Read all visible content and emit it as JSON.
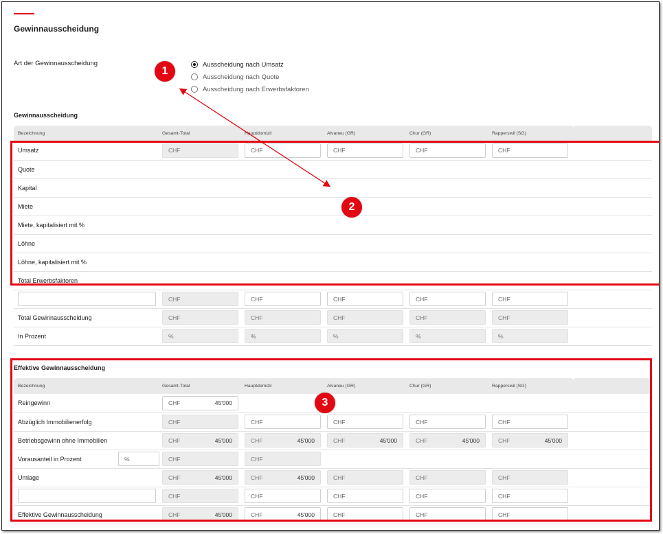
{
  "page_title": "Gewinnausscheidung",
  "art": {
    "label": "Art der Gewinnausscheidung",
    "options": [
      {
        "label": "Ausscheidung nach Umsatz",
        "selected": true
      },
      {
        "label": "Ausscheidung nach Quote",
        "selected": false
      },
      {
        "label": "Ausscheidung nach Erwerbsfaktoren",
        "selected": false
      }
    ]
  },
  "columns": [
    "Bezeichnung",
    "Gesamt-Total",
    "Hauptdomizil",
    "Alvaneu (GR)",
    "Chur (GR)",
    "Rapperswil (SG)"
  ],
  "section1": {
    "title": "Gewinnausscheidung",
    "rows": [
      {
        "label": "Umsatz",
        "cells": [
          {
            "ph": "CHF",
            "ro": true
          },
          {
            "ph": "CHF",
            "ro": false
          },
          {
            "ph": "CHF",
            "ro": false
          },
          {
            "ph": "CHF",
            "ro": false
          },
          {
            "ph": "CHF",
            "ro": false
          }
        ]
      },
      {
        "label": "Quote",
        "cells": []
      },
      {
        "label": "Kapital",
        "cells": []
      },
      {
        "label": "Miete",
        "cells": []
      },
      {
        "label": "Miete, kapitalisiert mit %",
        "cells": []
      },
      {
        "label": "Löhne",
        "cells": []
      },
      {
        "label": "Löhne, kapitalisiert mit %",
        "cells": []
      },
      {
        "label": "Total Erwerbsfaktoren",
        "cells": []
      },
      {
        "label": "",
        "name_input": true,
        "cells": [
          {
            "ph": "CHF",
            "ro": true
          },
          {
            "ph": "CHF",
            "ro": false
          },
          {
            "ph": "CHF",
            "ro": false
          },
          {
            "ph": "CHF",
            "ro": false
          },
          {
            "ph": "CHF",
            "ro": false
          }
        ]
      },
      {
        "label": "Total Gewinnausscheidung",
        "cells": [
          {
            "ph": "CHF",
            "ro": true
          },
          {
            "ph": "CHF",
            "ro": true
          },
          {
            "ph": "CHF",
            "ro": true
          },
          {
            "ph": "CHF",
            "ro": true
          },
          {
            "ph": "CHF",
            "ro": true
          }
        ]
      },
      {
        "label": "In Prozent",
        "cells": [
          {
            "ph": "%",
            "ro": true
          },
          {
            "ph": "%",
            "ro": true
          },
          {
            "ph": "%",
            "ro": true
          },
          {
            "ph": "%",
            "ro": true
          },
          {
            "ph": "%",
            "ro": true
          }
        ]
      }
    ]
  },
  "section2": {
    "title": "Effektive Gewinnausscheidung",
    "rows": [
      {
        "label": "Reingewinn",
        "cells": [
          {
            "ph": "CHF",
            "ro": false,
            "value": "45'000"
          }
        ]
      },
      {
        "label": "Abzüglich Immobilienerfolg",
        "cells": [
          {
            "ph": "CHF",
            "ro": true
          },
          {
            "ph": "CHF",
            "ro": false
          },
          {
            "ph": "CHF",
            "ro": false
          },
          {
            "ph": "CHF",
            "ro": false
          },
          {
            "ph": "CHF",
            "ro": false
          }
        ]
      },
      {
        "label": "Betriebsgewinn ohne Immobilien",
        "cells": [
          {
            "ph": "CHF",
            "ro": true,
            "value": "45'000"
          },
          {
            "ph": "CHF",
            "ro": true,
            "value": "45'000"
          },
          {
            "ph": "CHF",
            "ro": true,
            "value": "45'000"
          },
          {
            "ph": "CHF",
            "ro": true,
            "value": "45'000"
          },
          {
            "ph": "CHF",
            "ro": true,
            "value": "45'000"
          }
        ]
      },
      {
        "label": "Vorausanteil in Prozent",
        "pct_input": "%",
        "cells": [
          {
            "ph": "CHF",
            "ro": true
          },
          {
            "ph": "CHF",
            "ro": true
          }
        ]
      },
      {
        "label": "Umlage",
        "cells": [
          {
            "ph": "CHF",
            "ro": true,
            "value": "45'000"
          },
          {
            "ph": "CHF",
            "ro": true,
            "value": "45'000"
          },
          {
            "ph": "CHF",
            "ro": true
          },
          {
            "ph": "CHF",
            "ro": true
          },
          {
            "ph": "CHF",
            "ro": true
          }
        ]
      },
      {
        "label": "",
        "name_input": true,
        "cells": [
          {
            "ph": "CHF",
            "ro": true
          },
          {
            "ph": "CHF",
            "ro": false
          },
          {
            "ph": "CHF",
            "ro": false
          },
          {
            "ph": "CHF",
            "ro": false
          },
          {
            "ph": "CHF",
            "ro": false
          }
        ]
      },
      {
        "label": "Effektive Gewinnausscheidung",
        "cells": [
          {
            "ph": "CHF",
            "ro": true,
            "value": "45'000"
          },
          {
            "ph": "CHF",
            "ro": false,
            "value": "45'000"
          },
          {
            "ph": "CHF",
            "ro": false
          },
          {
            "ph": "CHF",
            "ro": false
          },
          {
            "ph": "CHF",
            "ro": false
          }
        ]
      }
    ]
  },
  "annotations": {
    "markers": [
      "1",
      "2",
      "3"
    ],
    "color": "#e30613"
  }
}
